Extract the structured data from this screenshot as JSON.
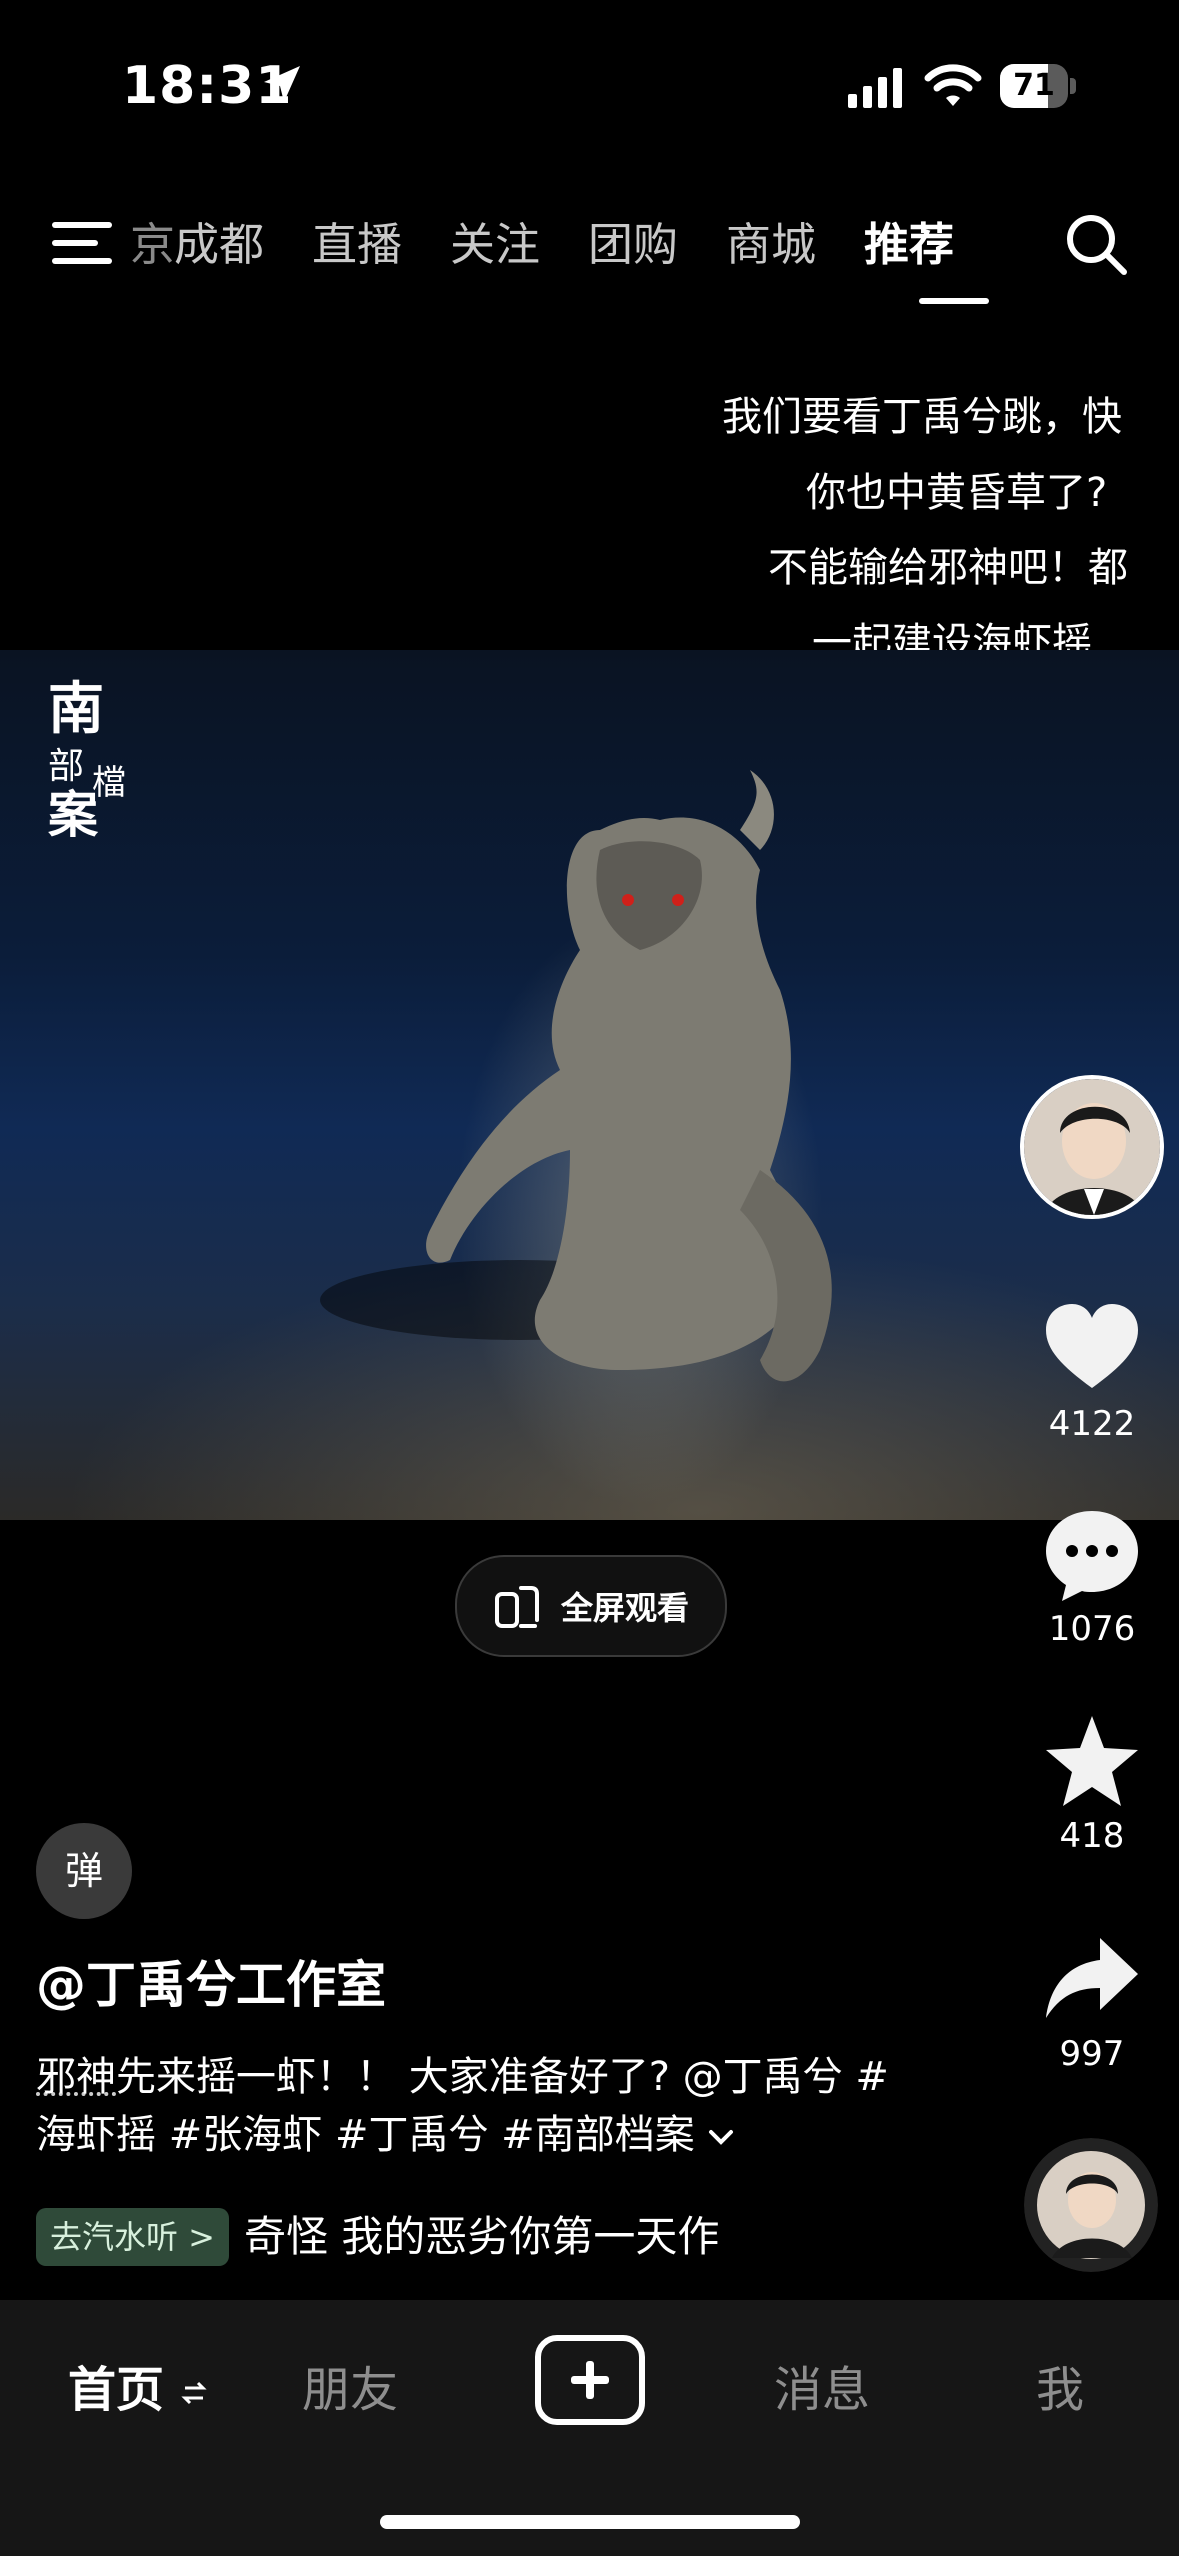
{
  "status_bar": {
    "time": "18:31",
    "battery_percent": "71",
    "battery_level": 0.71
  },
  "nav": {
    "tabs": [
      {
        "label": "京",
        "state": "partial"
      },
      {
        "label": "成都",
        "state": "normal"
      },
      {
        "label": "直播",
        "state": "normal"
      },
      {
        "label": "关注",
        "state": "normal"
      },
      {
        "label": "团购",
        "state": "normal"
      },
      {
        "label": "商城",
        "state": "normal"
      },
      {
        "label": "推荐",
        "state": "active"
      }
    ]
  },
  "danmaku": [
    "我们要看丁禹兮跳，快",
    "你也中黄昏草了?",
    "不能输给邪神吧！都",
    "一起建设海虾摇"
  ],
  "video": {
    "watermark_text": "南部檔案"
  },
  "fullscreen_label": "全屏观看",
  "actions": {
    "likes": "4122",
    "comments": "1076",
    "favorites": "418",
    "shares": "997"
  },
  "danmu_toggle_label": "弹",
  "author": "@丁禹兮工作室",
  "description": {
    "highlight": "邪神",
    "text": "先来摇一虾！！ 大家准备好了? @丁禹兮 #海虾摇 #张海虾 #丁禹兮 #南部档案"
  },
  "music": {
    "tag": "去汽水听 >",
    "text": "奇怪 我的恶劣你第一天作"
  },
  "bottom_nav": {
    "home": "首页",
    "friends": "朋友",
    "messages": "消息",
    "me": "我"
  },
  "icons": [
    "menu-icon",
    "search-icon",
    "heart-icon",
    "comment-icon",
    "star-icon",
    "share-icon",
    "plus-icon",
    "fullscreen-icon",
    "location-arrow-icon",
    "signal-icon",
    "wifi-icon"
  ]
}
